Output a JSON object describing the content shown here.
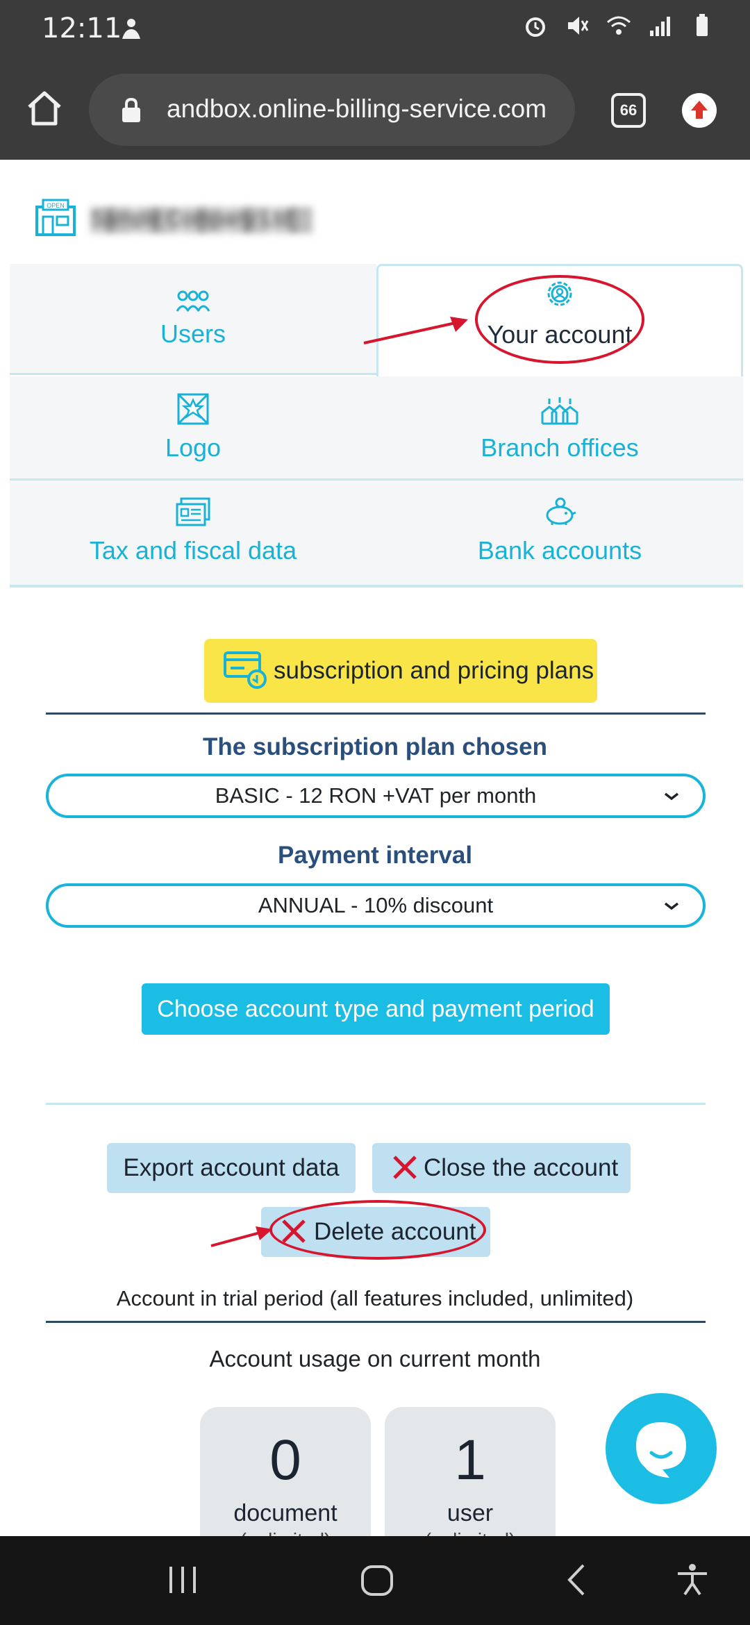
{
  "status_bar": {
    "time": "12:11"
  },
  "browser": {
    "url": "andbox.online-billing-service.com",
    "tab_count": "66"
  },
  "company": {
    "name": "Sample Company Ltd",
    "open_sign": "OPEN"
  },
  "settings_tabs": [
    {
      "label": "Users",
      "icon": "users-icon"
    },
    {
      "label": "Your account",
      "icon": "gear-users-icon"
    },
    {
      "label": "Logo",
      "icon": "logo-icon"
    },
    {
      "label": "Branch offices",
      "icon": "branch-offices-icon"
    },
    {
      "label": "Tax and fiscal data",
      "icon": "tax-data-icon"
    },
    {
      "label": "Bank accounts",
      "icon": "piggy-bank-icon"
    }
  ],
  "subscription": {
    "plans_button": "subscription and pricing plans",
    "plan_heading": "The subscription plan chosen",
    "plan_value": "BASIC - 12 RON +VAT per month",
    "interval_heading": "Payment interval",
    "interval_value": "ANNUAL - 10% discount",
    "choose_button": "Choose account type and payment period"
  },
  "account_actions": {
    "export": "Export account data",
    "close": "Close the account",
    "delete": "Delete account"
  },
  "trial_text": "Account in trial period (all features included, unlimited)",
  "usage": {
    "title": "Account usage on current month",
    "cards": [
      {
        "value": "0",
        "label": "document",
        "sub": "(unlimited)"
      },
      {
        "value": "1",
        "label": "user",
        "sub": "(unlimited)"
      }
    ]
  },
  "colors": {
    "accent": "#1cbde5",
    "highlight": "#f9e547",
    "annotation": "#d6152e",
    "heading": "#2a4f7c"
  }
}
